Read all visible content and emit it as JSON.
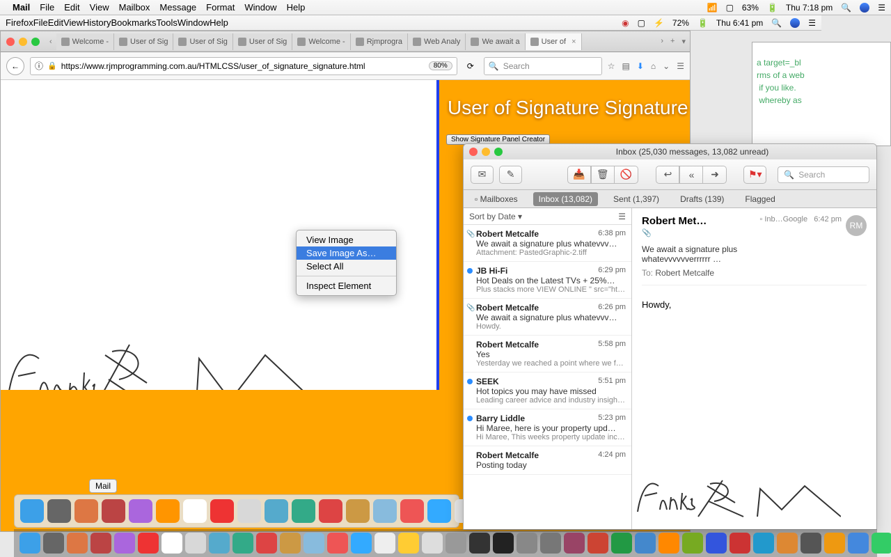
{
  "menubar1": {
    "app": "Mail",
    "items": [
      "File",
      "Edit",
      "View",
      "Mailbox",
      "Message",
      "Format",
      "Window",
      "Help"
    ],
    "battery": "63%",
    "clock": "Thu 7:18 pm"
  },
  "menubar2": {
    "app": "Firefox",
    "items": [
      "File",
      "Edit",
      "View",
      "History",
      "Bookmarks",
      "Tools",
      "Window",
      "Help"
    ],
    "battery": "72%",
    "clock": "Thu 6:41 pm"
  },
  "firefox": {
    "tabs": [
      "Welcome -",
      "User of Sig",
      "User of Sig",
      "User of Sig",
      "Welcome -",
      "Rjmprogra",
      "Web Analy",
      "We await a",
      "User of"
    ],
    "active_tab": 8,
    "url": "https://www.rjmprogramming.com.au/HTMLCSS/user_of_signature_signature.html",
    "zoom": "80%",
    "search_placeholder": "Search",
    "page": {
      "title": "User of Signature Signature",
      "button": "Show Signature Panel Creator"
    },
    "context_menu": {
      "items": [
        "View Image",
        "Save Image As…",
        "Select All"
      ],
      "sep_after": 2,
      "inspect": "Inspect Element",
      "selected": 1
    }
  },
  "mail": {
    "title": "Inbox (25,030 messages, 13,082 unread)",
    "search_placeholder": "Search",
    "tabs": {
      "mailboxes": "Mailboxes",
      "inbox": "Inbox (13,082)",
      "sent": "Sent (1,397)",
      "drafts": "Drafts (139)",
      "flagged": "Flagged"
    },
    "sort": "Sort by Date",
    "messages": [
      {
        "from": "Robert Metcalfe",
        "time": "6:38 pm",
        "subj": "We await a signature plus whatevvv…",
        "prev": "Attachment: PastedGraphic-2.tiff",
        "clip": true
      },
      {
        "from": "JB Hi-Fi",
        "time": "6:29 pm",
        "subj": "Hot Deals on the Latest TVs + 25%…",
        "prev": "Plus stacks more VIEW ONLINE \" src=\"http://image.e.jbhifi.com.au/lib/f…",
        "dot": true
      },
      {
        "from": "Robert Metcalfe",
        "time": "6:26 pm",
        "subj": "We await a signature plus whatevvv…",
        "prev": "Howdy.",
        "clip": true
      },
      {
        "from": "Robert Metcalfe",
        "time": "5:58 pm",
        "subj": "Yes",
        "prev": "Yesterday we reached a point where we feel we can draw a line under a uni…"
      },
      {
        "from": "SEEK",
        "time": "5:51 pm",
        "subj": "Hot topics you may have missed",
        "prev": "Leading career advice and industry insights from the experts at SEEK. Qu…",
        "dot": true
      },
      {
        "from": "Barry Liddle",
        "time": "5:23 pm",
        "subj": "Hi Maree, here is your property upd…",
        "prev": "Hi Maree, This weeks property update includes: + RECORD OF CAMPAIGN R…",
        "dot": true
      },
      {
        "from": "Robert Metcalfe",
        "time": "4:24 pm",
        "subj": "Posting today",
        "prev": ""
      }
    ],
    "view": {
      "sender": "Robert Met…",
      "folder": "Inb…Google",
      "time": "6:42 pm",
      "avatar": "RM",
      "subject": "We await a signature plus whatevvvvvverrrrrr …",
      "to_label": "To:",
      "to": "Robert Metcalfe",
      "body": "Howdy,"
    }
  },
  "code_lines": [
    "a target=_bl",
    "rms of a web",
    " if you like.",
    " whereby as"
  ],
  "dock_tooltip": "Mail",
  "signature_word": "Thanks"
}
